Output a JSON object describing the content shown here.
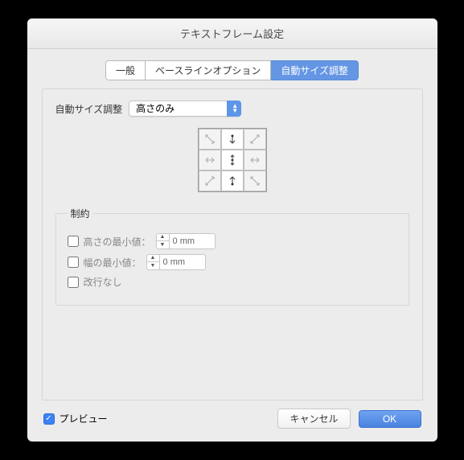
{
  "title": "テキストフレーム設定",
  "tabs": {
    "general": "一般",
    "baseline": "ベースラインオプション",
    "autosize": "自動サイズ調整"
  },
  "autosize_label": "自動サイズ調整",
  "autosize_value": "高さのみ",
  "constraints": {
    "legend": "制約",
    "min_height_label": "高さの最小値：",
    "min_height_value": "0 mm",
    "min_width_label": "幅の最小値：",
    "min_width_value": "0 mm",
    "no_break_label": "改行なし"
  },
  "footer": {
    "preview": "プレビュー",
    "cancel": "キャンセル",
    "ok": "OK"
  },
  "anchor_icons": [
    "⇲",
    "↧",
    "⇱",
    "⇢",
    "✦",
    "⇠",
    "⇱",
    "↥",
    "⇲"
  ]
}
